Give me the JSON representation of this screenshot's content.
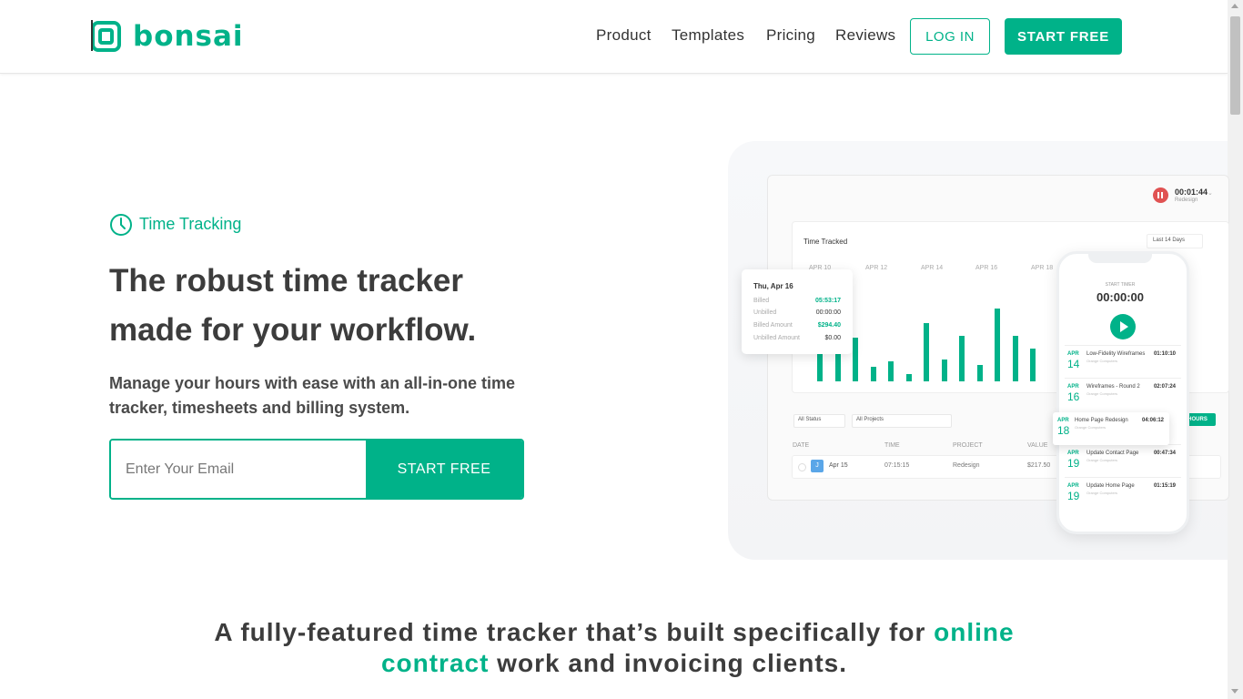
{
  "brand": {
    "name": "bonsai",
    "color": "#00b289"
  },
  "nav": {
    "items": [
      "Product",
      "Templates",
      "Pricing",
      "Reviews"
    ],
    "login": "LOG IN",
    "start": "START FREE"
  },
  "hero": {
    "eyebrow_icon": "clock-icon",
    "eyebrow": "Time Tracking",
    "title_line1": "The robust time tracker",
    "title_line2": "made for your workflow.",
    "subtitle": "Manage your hours with ease with an all-in-one time tracker, timesheets and billing system.",
    "email_placeholder": "Enter Your Email",
    "cta": "START FREE"
  },
  "mockup": {
    "timer": {
      "time": "00:01:44",
      "project": "Redesign"
    },
    "chart_title": "Time Tracked",
    "range": "Last 14 Days",
    "axis": [
      "APR 10",
      "APR 12",
      "APR 14",
      "APR 16",
      "APR 18"
    ],
    "bars": [
      0.45,
      0.55,
      0.6,
      0.2,
      0.28,
      0.1,
      0.8,
      0.3,
      0.62,
      0.22,
      1.0,
      0.62,
      0.45
    ],
    "popup": {
      "date": "Thu, Apr 16",
      "rows": [
        {
          "label": "Billed",
          "value": "05:53:17"
        },
        {
          "label": "Unbilled",
          "value": "00:00:00"
        },
        {
          "label": "Billed Amount",
          "value": "$294.40"
        },
        {
          "label": "Unbilled Amount",
          "value": "$0.00"
        }
      ]
    },
    "filters": {
      "status": "All Status",
      "projects": "All Projects",
      "hours_button": "HOURS"
    },
    "table": {
      "headers": [
        "DATE",
        "TIME",
        "PROJECT",
        "VALUE"
      ],
      "row": {
        "avatar": "J",
        "date": "Apr 15",
        "time": "07:15:15",
        "project": "Redesign",
        "value": "$217.50"
      }
    },
    "phone": {
      "label": "START TIMER",
      "timer": "00:00:00",
      "entries": [
        {
          "month": "APR",
          "day": "14",
          "title": "Low-Fidelity Wireframes",
          "client": "Orange Computers",
          "time": "01:10:10"
        },
        {
          "month": "APR",
          "day": "16",
          "title": "Wireframes - Round 2",
          "client": "Orange Computers",
          "time": "02:07:24"
        },
        {
          "month": "APR",
          "day": "18",
          "title": "Home Page Redesign",
          "client": "Orange Computers",
          "time": "04:06:12"
        },
        {
          "month": "APR",
          "day": "19",
          "title": "Update Contact Page",
          "client": "Orange Computers",
          "time": "00:47:34"
        },
        {
          "month": "APR",
          "day": "19",
          "title": "Update Home Page",
          "client": "Orange Computers",
          "time": "01:15:19"
        }
      ]
    }
  },
  "bottom": {
    "part1": "A fully-featured time tracker that’s built specifically for ",
    "accent": "online contract",
    "part2": " work and invoicing clients."
  }
}
